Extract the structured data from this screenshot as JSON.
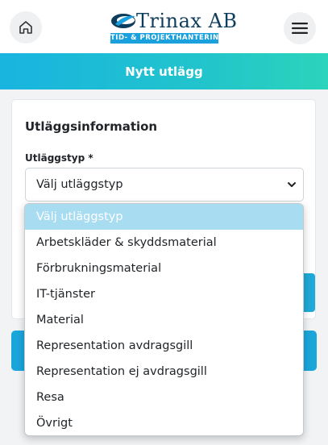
{
  "header": {
    "logo_name": "Trinax AB",
    "logo_tagline": "TID- & PROJEKTHANTERING",
    "home_icon": "home-icon",
    "menu_icon": "hamburger-menu-icon"
  },
  "page": {
    "title": "Nytt utlägg"
  },
  "form": {
    "section_title": "Utläggsinformation",
    "type_label": "Utläggstyp *",
    "type_selected": "Välj utläggstyp"
  },
  "dropdown": {
    "options": [
      "Välj utläggstyp",
      "Arbetskläder & skyddsmaterial",
      "Förbrukningsmaterial",
      "IT-tjänster",
      "Material",
      "Representation avdragsgill",
      "Representation ej avdragsgill",
      "Resa",
      "Övrigt"
    ],
    "highlighted_index": 0
  },
  "colors": {
    "accent": "#1ba6db",
    "gradient_end": "#2bd4bb",
    "highlight": "#a8dcf1",
    "logo_dark": "#0d3d5c"
  }
}
